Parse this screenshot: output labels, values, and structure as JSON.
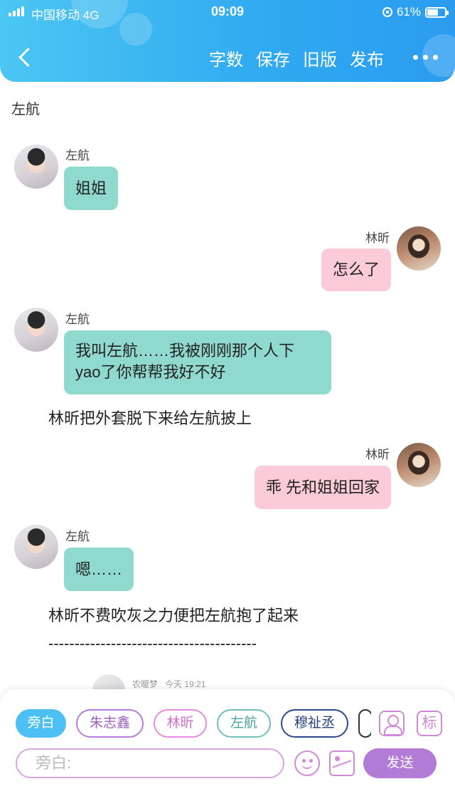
{
  "status_bar": {
    "carrier": "中国移动  4G",
    "time": "09:09",
    "battery": "61%",
    "battery_level": 0.61
  },
  "nav": {
    "actions": [
      "字数",
      "保存",
      "旧版",
      "发布"
    ]
  },
  "chat": {
    "title": "左航",
    "messages": [
      {
        "side": "left",
        "sender": "左航",
        "text": "姐姐"
      },
      {
        "side": "right",
        "sender": "林昕",
        "text": "怎么了"
      },
      {
        "side": "left",
        "sender": "左航",
        "lines": [
          "我叫左航……我被刚刚那个人下",
          "yao了你帮帮我好不好"
        ]
      },
      {
        "type": "narration",
        "text": "林昕把外套脱下来给左航披上"
      },
      {
        "side": "right",
        "sender": "林昕",
        "text": "乖 先和姐姐回家"
      },
      {
        "side": "left",
        "sender": "左航",
        "text": "嗯……"
      },
      {
        "type": "narration",
        "text": "林昕不费吹灰之力便把左航抱了起来"
      },
      {
        "type": "divider",
        "text": "----------------------------------------"
      }
    ],
    "comment_peek": {
      "user": "农暖梦",
      "time": "今天 19:21"
    }
  },
  "composer": {
    "roles": [
      "旁白",
      "朱志鑫",
      "林昕",
      "左航",
      "穆祉丞",
      ""
    ],
    "role_colors": [
      "#4cc0f2",
      "#b77ddc",
      "#e68be0",
      "#6fbfbd",
      "#2a4a8a",
      "#333333"
    ],
    "tag_label": "标",
    "placeholder": "旁白:",
    "send_label": "发送"
  }
}
